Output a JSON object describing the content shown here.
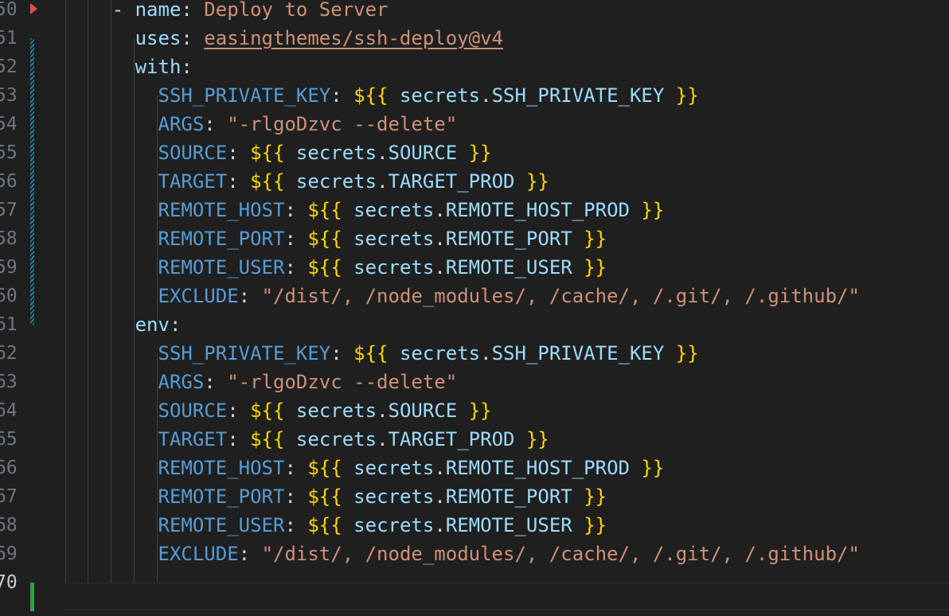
{
  "editor": {
    "lines": [
      {
        "num": "50",
        "segments": [
          [
            "dash",
            "      - "
          ],
          [
            "key2",
            "name"
          ],
          [
            "punc",
            ": "
          ],
          [
            "str",
            "Deploy to Server"
          ]
        ]
      },
      {
        "num": "51",
        "segments": [
          [
            "punc",
            "        "
          ],
          [
            "key2",
            "uses"
          ],
          [
            "punc",
            ": "
          ],
          [
            "strlink",
            "easingthemes/ssh-deploy@v4"
          ]
        ]
      },
      {
        "num": "52",
        "segments": [
          [
            "punc",
            "        "
          ],
          [
            "key2",
            "with"
          ],
          [
            "punc",
            ":"
          ]
        ]
      },
      {
        "num": "53",
        "segments": [
          [
            "punc",
            "          "
          ],
          [
            "key",
            "SSH_PRIVATE_KEY"
          ],
          [
            "punc",
            ": "
          ],
          [
            "tmpl",
            "${{"
          ],
          [
            "punc",
            " "
          ],
          [
            "var",
            "secrets"
          ],
          [
            "punc",
            "."
          ],
          [
            "key2",
            "SSH_PRIVATE_KEY"
          ],
          [
            "punc",
            " "
          ],
          [
            "tmpl",
            "}}"
          ]
        ]
      },
      {
        "num": "54",
        "segments": [
          [
            "punc",
            "          "
          ],
          [
            "key",
            "ARGS"
          ],
          [
            "punc",
            ": "
          ],
          [
            "str",
            "\"-rlgoDzvc --delete\""
          ]
        ]
      },
      {
        "num": "55",
        "segments": [
          [
            "punc",
            "          "
          ],
          [
            "key",
            "SOURCE"
          ],
          [
            "punc",
            ": "
          ],
          [
            "tmpl",
            "${{"
          ],
          [
            "punc",
            " "
          ],
          [
            "var",
            "secrets"
          ],
          [
            "punc",
            "."
          ],
          [
            "key2",
            "SOURCE"
          ],
          [
            "punc",
            " "
          ],
          [
            "tmpl",
            "}}"
          ]
        ]
      },
      {
        "num": "56",
        "segments": [
          [
            "punc",
            "          "
          ],
          [
            "key",
            "TARGET"
          ],
          [
            "punc",
            ": "
          ],
          [
            "tmpl",
            "${{"
          ],
          [
            "punc",
            " "
          ],
          [
            "var",
            "secrets"
          ],
          [
            "punc",
            "."
          ],
          [
            "key2",
            "TARGET_PROD"
          ],
          [
            "punc",
            " "
          ],
          [
            "tmpl",
            "}}"
          ]
        ]
      },
      {
        "num": "57",
        "segments": [
          [
            "punc",
            "          "
          ],
          [
            "key",
            "REMOTE_HOST"
          ],
          [
            "punc",
            ": "
          ],
          [
            "tmpl",
            "${{"
          ],
          [
            "punc",
            " "
          ],
          [
            "var",
            "secrets"
          ],
          [
            "punc",
            "."
          ],
          [
            "key2",
            "REMOTE_HOST_PROD"
          ],
          [
            "punc",
            " "
          ],
          [
            "tmpl",
            "}}"
          ]
        ]
      },
      {
        "num": "58",
        "segments": [
          [
            "punc",
            "          "
          ],
          [
            "key",
            "REMOTE_PORT"
          ],
          [
            "punc",
            ": "
          ],
          [
            "tmpl",
            "${{"
          ],
          [
            "punc",
            " "
          ],
          [
            "var",
            "secrets"
          ],
          [
            "punc",
            "."
          ],
          [
            "key2",
            "REMOTE_PORT"
          ],
          [
            "punc",
            " "
          ],
          [
            "tmpl",
            "}}"
          ]
        ]
      },
      {
        "num": "59",
        "segments": [
          [
            "punc",
            "          "
          ],
          [
            "key",
            "REMOTE_USER"
          ],
          [
            "punc",
            ": "
          ],
          [
            "tmpl",
            "${{"
          ],
          [
            "punc",
            " "
          ],
          [
            "var",
            "secrets"
          ],
          [
            "punc",
            "."
          ],
          [
            "key2",
            "REMOTE_USER"
          ],
          [
            "punc",
            " "
          ],
          [
            "tmpl",
            "}}"
          ]
        ]
      },
      {
        "num": "60",
        "segments": [
          [
            "punc",
            "          "
          ],
          [
            "key",
            "EXCLUDE"
          ],
          [
            "punc",
            ": "
          ],
          [
            "str",
            "\"/dist/, /node_modules/, /cache/, /.git/, /.github/\""
          ]
        ]
      },
      {
        "num": "61",
        "segments": [
          [
            "punc",
            "        "
          ],
          [
            "key2",
            "env"
          ],
          [
            "punc",
            ":"
          ]
        ]
      },
      {
        "num": "62",
        "segments": [
          [
            "punc",
            "          "
          ],
          [
            "key",
            "SSH_PRIVATE_KEY"
          ],
          [
            "punc",
            ": "
          ],
          [
            "tmpl",
            "${{"
          ],
          [
            "punc",
            " "
          ],
          [
            "var",
            "secrets"
          ],
          [
            "punc",
            "."
          ],
          [
            "key2",
            "SSH_PRIVATE_KEY"
          ],
          [
            "punc",
            " "
          ],
          [
            "tmpl",
            "}}"
          ]
        ]
      },
      {
        "num": "63",
        "segments": [
          [
            "punc",
            "          "
          ],
          [
            "key",
            "ARGS"
          ],
          [
            "punc",
            ": "
          ],
          [
            "str",
            "\"-rlgoDzvc --delete\""
          ]
        ]
      },
      {
        "num": "64",
        "segments": [
          [
            "punc",
            "          "
          ],
          [
            "key",
            "SOURCE"
          ],
          [
            "punc",
            ": "
          ],
          [
            "tmpl",
            "${{"
          ],
          [
            "punc",
            " "
          ],
          [
            "var",
            "secrets"
          ],
          [
            "punc",
            "."
          ],
          [
            "key2",
            "SOURCE"
          ],
          [
            "punc",
            " "
          ],
          [
            "tmpl",
            "}}"
          ]
        ]
      },
      {
        "num": "65",
        "segments": [
          [
            "punc",
            "          "
          ],
          [
            "key",
            "TARGET"
          ],
          [
            "punc",
            ": "
          ],
          [
            "tmpl",
            "${{"
          ],
          [
            "punc",
            " "
          ],
          [
            "var",
            "secrets"
          ],
          [
            "punc",
            "."
          ],
          [
            "key2",
            "TARGET_PROD"
          ],
          [
            "punc",
            " "
          ],
          [
            "tmpl",
            "}}"
          ]
        ]
      },
      {
        "num": "66",
        "segments": [
          [
            "punc",
            "          "
          ],
          [
            "key",
            "REMOTE_HOST"
          ],
          [
            "punc",
            ": "
          ],
          [
            "tmpl",
            "${{"
          ],
          [
            "punc",
            " "
          ],
          [
            "var",
            "secrets"
          ],
          [
            "punc",
            "."
          ],
          [
            "key2",
            "REMOTE_HOST_PROD"
          ],
          [
            "punc",
            " "
          ],
          [
            "tmpl",
            "}}"
          ]
        ]
      },
      {
        "num": "67",
        "segments": [
          [
            "punc",
            "          "
          ],
          [
            "key",
            "REMOTE_PORT"
          ],
          [
            "punc",
            ": "
          ],
          [
            "tmpl",
            "${{"
          ],
          [
            "punc",
            " "
          ],
          [
            "var",
            "secrets"
          ],
          [
            "punc",
            "."
          ],
          [
            "key2",
            "REMOTE_PORT"
          ],
          [
            "punc",
            " "
          ],
          [
            "tmpl",
            "}}"
          ]
        ]
      },
      {
        "num": "68",
        "segments": [
          [
            "punc",
            "          "
          ],
          [
            "key",
            "REMOTE_USER"
          ],
          [
            "punc",
            ": "
          ],
          [
            "tmpl",
            "${{"
          ],
          [
            "punc",
            " "
          ],
          [
            "var",
            "secrets"
          ],
          [
            "punc",
            "."
          ],
          [
            "key2",
            "REMOTE_USER"
          ],
          [
            "punc",
            " "
          ],
          [
            "tmpl",
            "}}"
          ]
        ]
      },
      {
        "num": "69",
        "segments": [
          [
            "punc",
            "          "
          ],
          [
            "key",
            "EXCLUDE"
          ],
          [
            "punc",
            ": "
          ],
          [
            "str",
            "\"/dist/, /node_modules/, /cache/, /.git/, /.github/\""
          ]
        ]
      },
      {
        "num": "70",
        "segments": []
      }
    ],
    "active_line": "70",
    "colors": {
      "background": "#1f1f1f",
      "modified_gutter": "#1b81a8",
      "added_gutter": "#2ea043",
      "fold_marker": "#f14c4c"
    }
  }
}
